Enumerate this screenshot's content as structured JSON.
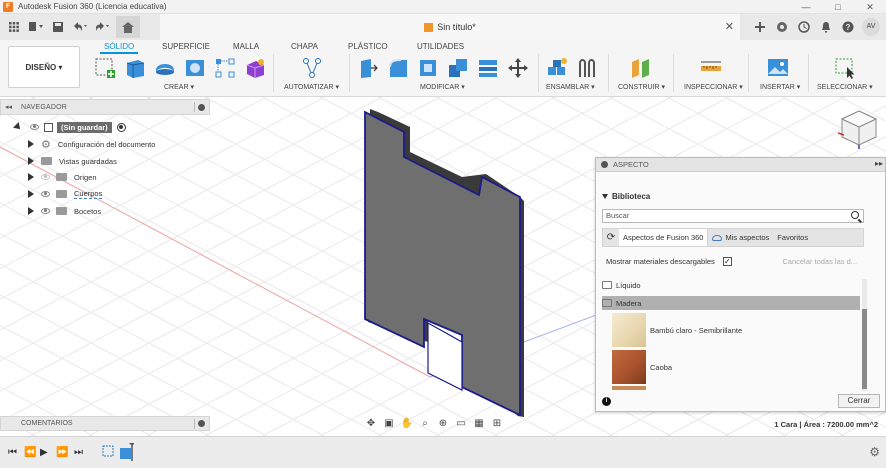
{
  "window": {
    "title": "Autodesk Fusion 360 (Licencia educativa)",
    "logo_letter": "F",
    "controls": [
      "—",
      "□",
      "✕"
    ]
  },
  "doc": {
    "title": "Sin título*",
    "close": "✕"
  },
  "user": {
    "initials": "AV"
  },
  "ribbon": {
    "workspace": "DISEÑO ▾",
    "tabs": [
      "SÓLIDO",
      "SUPERFICIE",
      "MALLA",
      "CHAPA",
      "PLÁSTICO",
      "UTILIDADES"
    ],
    "groups": [
      "CREAR ▾",
      "AUTOMATIZAR ▾",
      "MODIFICAR ▾",
      "ENSAMBLAR ▾",
      "CONSTRUIR ▾",
      "INSPECCIONAR ▾",
      "INSERTAR ▾",
      "SELECCIONAR ▾"
    ]
  },
  "navigator": {
    "title": "NAVEGADOR",
    "root": "(Sin guardar)",
    "items": [
      "Configuración del documento",
      "Vistas guardadas",
      "Origen",
      "Cuerpos",
      "Bocetos"
    ]
  },
  "comments": {
    "title": "COMENTARIOS"
  },
  "appearance": {
    "title": "ASPECTO",
    "library_title": "Biblioteca",
    "search_placeholder": "Buscar",
    "tabs": [
      "Aspectos de Fusion 360",
      "Mis aspectos",
      "Favoritos"
    ],
    "show_downloadable": "Mostrar materiales descargables",
    "show_downloadable_checked": true,
    "cancel_downloads": "Cancelar todas las d...",
    "categories": [
      "Líquido",
      "Madera"
    ],
    "materials": [
      {
        "name": "Bambú claro - Semibrillante",
        "color": "#efe3c4"
      },
      {
        "name": "Caoba",
        "color": "#a9532e"
      }
    ],
    "close_label": "Cerrar"
  },
  "status": {
    "selection": "1 Cara | Área : 7200.00 mm^2"
  },
  "colors": {
    "accent": "#0696d7",
    "body_face": "#6f6f6f",
    "body_edge": "#1b1b8c"
  }
}
